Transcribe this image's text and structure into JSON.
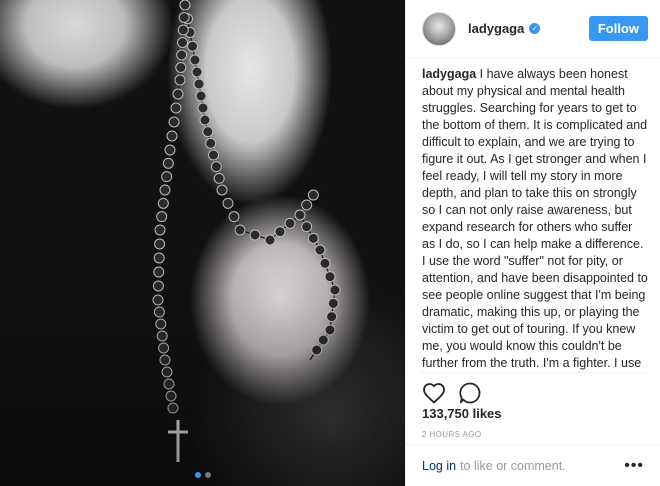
{
  "post": {
    "username": "ladygaga",
    "verified_badge": "verified-checkmark-icon",
    "follow_label": "Follow",
    "caption_author": "ladygaga",
    "caption_text": " I have always been honest about my physical and mental health struggles. Searching for years to get to the bottom of them. It is complicated and difficult to explain, and we are trying to figure it out. As I get stronger and when I feel ready, I will tell my story in more depth, and plan to take this on strongly so I can not only raise awareness, but expand research for others who suffer as I do, so I can help make a difference. I use the word \"suffer\" not for pity, or attention, and have been disappointed to see people online suggest that I'm being dramatic, making this up, or playing the victim to get out of touring. If you knew me, you would know this couldn't be further from the truth. I'm a fighter. I use the word suffer not only because trauma and chronic pain have changed my life, but because they are keeping me from living a",
    "likes": "133,750 likes",
    "timestamp": "2 HOURS AGO",
    "carousel_total": 2,
    "carousel_current": 1
  },
  "footer": {
    "login_label": "Log in",
    "suffix_text": "to like or comment.",
    "more_icon": "more-options-icon"
  },
  "colors": {
    "accent": "#3897f0",
    "link": "#003569",
    "muted": "#999999"
  }
}
